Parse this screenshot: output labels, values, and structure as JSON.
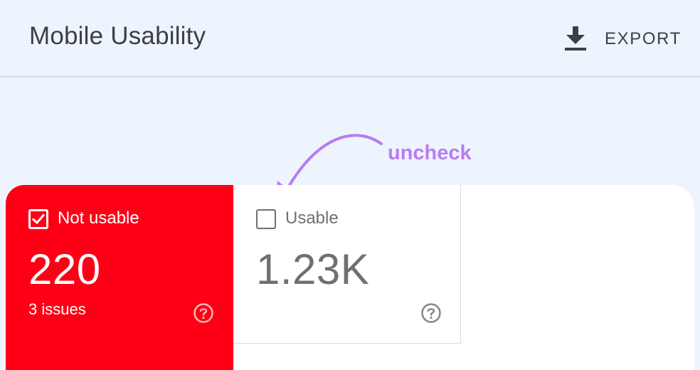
{
  "header": {
    "title": "Mobile Usability",
    "export_label": "EXPORT",
    "export_icon": "download-icon"
  },
  "annotation": {
    "text": "uncheck",
    "color": "#b97cf2"
  },
  "cards": [
    {
      "label": "Not usable",
      "value": "220",
      "subtext": "3 issues",
      "checked": true,
      "color": "#fe0016",
      "icon": "help-icon"
    },
    {
      "label": "Usable",
      "value": "1.23K",
      "checked": false,
      "color": "#707070",
      "icon": "help-icon"
    }
  ]
}
